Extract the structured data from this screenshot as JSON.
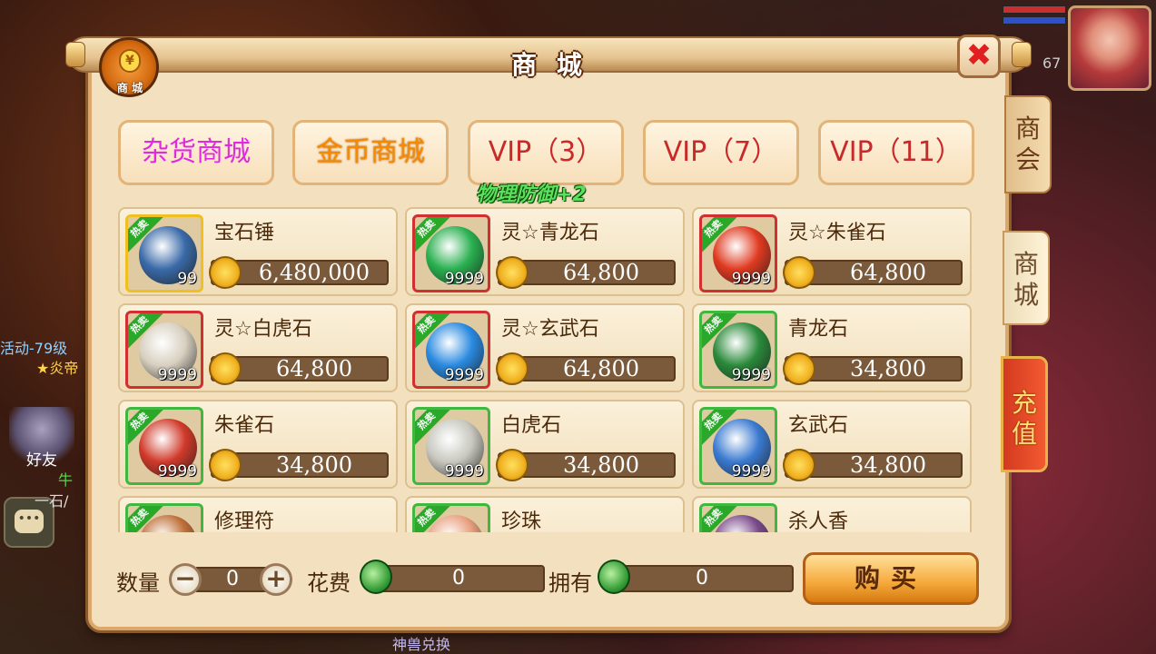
{
  "hud": {
    "level": "67",
    "event_text": "活动-79级",
    "event_sub": "★炎帝",
    "friend_label": "好友",
    "chat_icon": "speech-bubble",
    "frag1": "牛",
    "frag2": "一石/",
    "bottom_frag": "神兽兑换"
  },
  "window": {
    "title": "商 城",
    "icon_label": "商 城",
    "icon_glyph": "¥",
    "close_label": "✖"
  },
  "side_tabs": [
    "商会",
    "商城",
    "充值"
  ],
  "categories": [
    "杂货商城",
    "金币商城",
    "VIP（3）",
    "VIP（7）",
    "VIP（11）"
  ],
  "floating_text": "物理防御+2",
  "hot_label": "热卖",
  "items": [
    {
      "name": "宝石锤",
      "qty": "99",
      "price": "6,480,000",
      "frame": "gold",
      "color": "#3a6aa8"
    },
    {
      "name": "灵☆青龙石",
      "qty": "9999",
      "price": "64,800",
      "frame": "red",
      "color": "#2ab050"
    },
    {
      "name": "灵☆朱雀石",
      "qty": "9999",
      "price": "64,800",
      "frame": "red",
      "color": "#e03a20"
    },
    {
      "name": "灵☆白虎石",
      "qty": "9999",
      "price": "64,800",
      "frame": "red",
      "color": "#d8d0c0"
    },
    {
      "name": "灵☆玄武石",
      "qty": "9999",
      "price": "64,800",
      "frame": "red",
      "color": "#2a8ae0"
    },
    {
      "name": "青龙石",
      "qty": "9999",
      "price": "34,800",
      "frame": "green",
      "color": "#2a8a3a"
    },
    {
      "name": "朱雀石",
      "qty": "9999",
      "price": "34,800",
      "frame": "green",
      "color": "#d03a2a"
    },
    {
      "name": "白虎石",
      "qty": "9999",
      "price": "34,800",
      "frame": "green",
      "color": "#c8c8c0"
    },
    {
      "name": "玄武石",
      "qty": "9999",
      "price": "34,800",
      "frame": "green",
      "color": "#3a7ad0"
    },
    {
      "name": "修理符",
      "qty": "",
      "price": "",
      "frame": "green",
      "color": "#c0703a"
    },
    {
      "name": "珍珠",
      "qty": "",
      "price": "",
      "frame": "green",
      "color": "#e8a080"
    },
    {
      "name": "杀人香",
      "qty": "",
      "price": "",
      "frame": "green",
      "color": "#7a4a8a"
    }
  ],
  "bottom": {
    "qty_label": "数量",
    "qty_value": "0",
    "minus": "−",
    "plus": "+",
    "cost_label": "花费",
    "cost_value": "0",
    "own_label": "拥有",
    "own_value": "0",
    "buy_label": "购买"
  }
}
